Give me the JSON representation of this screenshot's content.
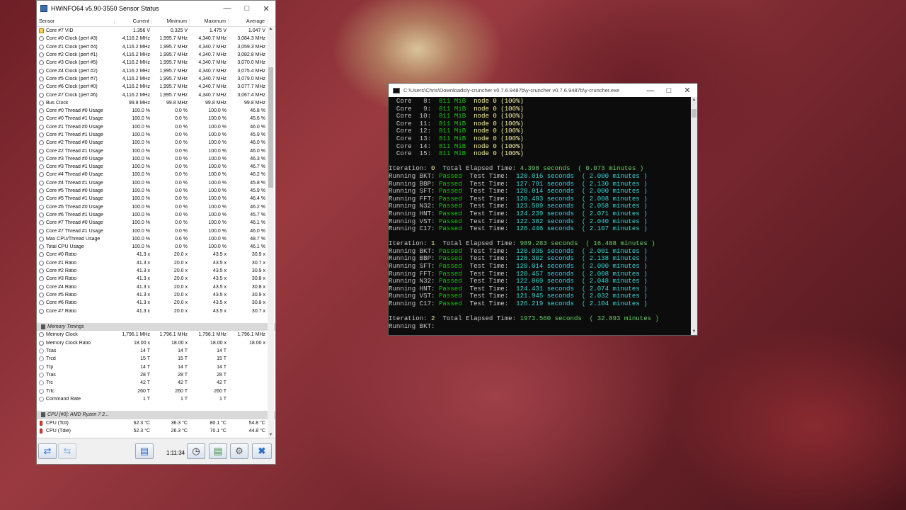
{
  "hwinfo": {
    "title": "HWiNFO64 v5.90-3550 Sensor Status",
    "columns": [
      "Sensor",
      "Current",
      "Minimum",
      "Maximum",
      "Average"
    ],
    "rows": [
      {
        "type": "row",
        "icon": "volt",
        "name": "Core #7 VID",
        "cur": "1.356 V",
        "min": "0.325 V",
        "max": "1.475 V",
        "avg": "1.047 V"
      },
      {
        "type": "row",
        "icon": "clock",
        "name": "Core #0 Clock (perf #3)",
        "cur": "4,116.2 MHz",
        "min": "1,995.7 MHz",
        "max": "4,340.7 MHz",
        "avg": "3,084.3 MHz"
      },
      {
        "type": "row",
        "icon": "clock",
        "name": "Core #1 Clock (perf #4)",
        "cur": "4,116.2 MHz",
        "min": "1,995.7 MHz",
        "max": "4,340.7 MHz",
        "avg": "3,059.3 MHz"
      },
      {
        "type": "row",
        "icon": "clock",
        "name": "Core #2 Clock (perf #1)",
        "cur": "4,116.2 MHz",
        "min": "1,995.7 MHz",
        "max": "4,340.7 MHz",
        "avg": "3,082.8 MHz"
      },
      {
        "type": "row",
        "icon": "clock",
        "name": "Core #3 Clock (perf #5)",
        "cur": "4,116.2 MHz",
        "min": "1,995.7 MHz",
        "max": "4,340.7 MHz",
        "avg": "3,070.0 MHz"
      },
      {
        "type": "row",
        "icon": "clock",
        "name": "Core #4 Clock (perf #2)",
        "cur": "4,116.2 MHz",
        "min": "1,995.7 MHz",
        "max": "4,340.7 MHz",
        "avg": "3,075.4 MHz"
      },
      {
        "type": "row",
        "icon": "clock",
        "name": "Core #5 Clock (perf #7)",
        "cur": "4,116.2 MHz",
        "min": "1,995.7 MHz",
        "max": "4,340.7 MHz",
        "avg": "3,079.0 MHz"
      },
      {
        "type": "row",
        "icon": "clock",
        "name": "Core #6 Clock (perf #0)",
        "cur": "4,116.2 MHz",
        "min": "1,995.7 MHz",
        "max": "4,340.7 MHz",
        "avg": "3,077.7 MHz"
      },
      {
        "type": "row",
        "icon": "clock",
        "name": "Core #7 Clock (perf #6)",
        "cur": "4,116.2 MHz",
        "min": "1,995.7 MHz",
        "max": "4,340.7 MHz",
        "avg": "3,067.4 MHz"
      },
      {
        "type": "row",
        "icon": "clock",
        "name": "Bus Clock",
        "cur": "99.8 MHz",
        "min": "99.8 MHz",
        "max": "99.8 MHz",
        "avg": "99.8 MHz"
      },
      {
        "type": "row",
        "icon": "clock",
        "name": "Core #0 Thread #0 Usage",
        "cur": "100.0 %",
        "min": "0.0 %",
        "max": "100.0 %",
        "avg": "46.8 %"
      },
      {
        "type": "row",
        "icon": "clock",
        "name": "Core #0 Thread #1 Usage",
        "cur": "100.0 %",
        "min": "0.0 %",
        "max": "100.0 %",
        "avg": "45.6 %"
      },
      {
        "type": "row",
        "icon": "clock",
        "name": "Core #1 Thread #0 Usage",
        "cur": "100.0 %",
        "min": "0.0 %",
        "max": "100.0 %",
        "avg": "46.0 %"
      },
      {
        "type": "row",
        "icon": "clock",
        "name": "Core #1 Thread #1 Usage",
        "cur": "100.0 %",
        "min": "0.0 %",
        "max": "100.0 %",
        "avg": "45.9 %"
      },
      {
        "type": "row",
        "icon": "clock",
        "name": "Core #2 Thread #0 Usage",
        "cur": "100.0 %",
        "min": "0.0 %",
        "max": "100.0 %",
        "avg": "46.0 %"
      },
      {
        "type": "row",
        "icon": "clock",
        "name": "Core #2 Thread #1 Usage",
        "cur": "100.0 %",
        "min": "0.0 %",
        "max": "100.0 %",
        "avg": "46.0 %"
      },
      {
        "type": "row",
        "icon": "clock",
        "name": "Core #3 Thread #0 Usage",
        "cur": "100.0 %",
        "min": "0.0 %",
        "max": "100.0 %",
        "avg": "46.3 %"
      },
      {
        "type": "row",
        "icon": "clock",
        "name": "Core #3 Thread #1 Usage",
        "cur": "100.0 %",
        "min": "0.0 %",
        "max": "100.0 %",
        "avg": "46.7 %"
      },
      {
        "type": "row",
        "icon": "clock",
        "name": "Core #4 Thread #0 Usage",
        "cur": "100.0 %",
        "min": "0.0 %",
        "max": "100.0 %",
        "avg": "46.2 %"
      },
      {
        "type": "row",
        "icon": "clock",
        "name": "Core #4 Thread #1 Usage",
        "cur": "100.0 %",
        "min": "0.0 %",
        "max": "100.0 %",
        "avg": "45.8 %"
      },
      {
        "type": "row",
        "icon": "clock",
        "name": "Core #5 Thread #0 Usage",
        "cur": "100.0 %",
        "min": "0.0 %",
        "max": "100.0 %",
        "avg": "45.9 %"
      },
      {
        "type": "row",
        "icon": "clock",
        "name": "Core #5 Thread #1 Usage",
        "cur": "100.0 %",
        "min": "0.0 %",
        "max": "100.0 %",
        "avg": "46.4 %"
      },
      {
        "type": "row",
        "icon": "clock",
        "name": "Core #6 Thread #0 Usage",
        "cur": "100.0 %",
        "min": "0.0 %",
        "max": "100.0 %",
        "avg": "46.2 %"
      },
      {
        "type": "row",
        "icon": "clock",
        "name": "Core #6 Thread #1 Usage",
        "cur": "100.0 %",
        "min": "0.0 %",
        "max": "100.0 %",
        "avg": "45.7 %"
      },
      {
        "type": "row",
        "icon": "clock",
        "name": "Core #7 Thread #0 Usage",
        "cur": "100.0 %",
        "min": "0.0 %",
        "max": "100.0 %",
        "avg": "46.1 %"
      },
      {
        "type": "row",
        "icon": "clock",
        "name": "Core #7 Thread #1 Usage",
        "cur": "100.0 %",
        "min": "0.0 %",
        "max": "100.0 %",
        "avg": "46.0 %"
      },
      {
        "type": "row",
        "icon": "clock",
        "name": "Max CPU/Thread Usage",
        "cur": "100.0 %",
        "min": "0.6 %",
        "max": "100.0 %",
        "avg": "48.7 %"
      },
      {
        "type": "row",
        "icon": "clock",
        "name": "Total CPU Usage",
        "cur": "100.0 %",
        "min": "0.0 %",
        "max": "100.0 %",
        "avg": "46.1 %"
      },
      {
        "type": "row",
        "icon": "clock",
        "name": "Core #0 Ratio",
        "cur": "41.3 x",
        "min": "20.0 x",
        "max": "43.5 x",
        "avg": "30.9 x"
      },
      {
        "type": "row",
        "icon": "clock",
        "name": "Core #1 Ratio",
        "cur": "41.3 x",
        "min": "20.0 x",
        "max": "43.5 x",
        "avg": "30.7 x"
      },
      {
        "type": "row",
        "icon": "clock",
        "name": "Core #2 Ratio",
        "cur": "41.3 x",
        "min": "20.0 x",
        "max": "43.5 x",
        "avg": "30.9 x"
      },
      {
        "type": "row",
        "icon": "clock",
        "name": "Core #3 Ratio",
        "cur": "41.3 x",
        "min": "20.0 x",
        "max": "43.5 x",
        "avg": "30.8 x"
      },
      {
        "type": "row",
        "icon": "clock",
        "name": "Core #4 Ratio",
        "cur": "41.3 x",
        "min": "20.0 x",
        "max": "43.5 x",
        "avg": "30.8 x"
      },
      {
        "type": "row",
        "icon": "clock",
        "name": "Core #5 Ratio",
        "cur": "41.3 x",
        "min": "20.0 x",
        "max": "43.5 x",
        "avg": "30.9 x"
      },
      {
        "type": "row",
        "icon": "clock",
        "name": "Core #6 Ratio",
        "cur": "41.3 x",
        "min": "20.0 x",
        "max": "43.5 x",
        "avg": "30.8 x"
      },
      {
        "type": "row",
        "icon": "clock",
        "name": "Core #7 Ratio",
        "cur": "41.3 x",
        "min": "20.0 x",
        "max": "43.5 x",
        "avg": "30.7 x"
      },
      {
        "type": "spacer"
      },
      {
        "type": "group",
        "name": "Memory Timings"
      },
      {
        "type": "row",
        "icon": "clock",
        "name": "Memory Clock",
        "cur": "1,796.1 MHz",
        "min": "1,796.1 MHz",
        "max": "1,796.1 MHz",
        "avg": "1,796.1 MHz"
      },
      {
        "type": "row",
        "icon": "clock",
        "name": "Memory Clock Ratio",
        "cur": "18.00 x",
        "min": "18.00 x",
        "max": "18.00 x",
        "avg": "18.00 x"
      },
      {
        "type": "row",
        "icon": "plain",
        "name": "Tcas",
        "cur": "14 T",
        "min": "14 T",
        "max": "14 T",
        "avg": ""
      },
      {
        "type": "row",
        "icon": "plain",
        "name": "Trcd",
        "cur": "15 T",
        "min": "15 T",
        "max": "15 T",
        "avg": ""
      },
      {
        "type": "row",
        "icon": "plain",
        "name": "Trp",
        "cur": "14 T",
        "min": "14 T",
        "max": "14 T",
        "avg": ""
      },
      {
        "type": "row",
        "icon": "plain",
        "name": "Tras",
        "cur": "28 T",
        "min": "28 T",
        "max": "28 T",
        "avg": ""
      },
      {
        "type": "row",
        "icon": "plain",
        "name": "Trc",
        "cur": "42 T",
        "min": "42 T",
        "max": "42 T",
        "avg": ""
      },
      {
        "type": "row",
        "icon": "plain",
        "name": "Trfc",
        "cur": "260 T",
        "min": "260 T",
        "max": "260 T",
        "avg": ""
      },
      {
        "type": "row",
        "icon": "plain",
        "name": "Command Rate",
        "cur": "1 T",
        "min": "1 T",
        "max": "1 T",
        "avg": ""
      },
      {
        "type": "spacer"
      },
      {
        "type": "group",
        "name": "CPU [#0]: AMD Ryzen 7 2..."
      },
      {
        "type": "row",
        "icon": "therm",
        "name": "CPU (Tctl)",
        "cur": "62.3 °C",
        "min": "36.3 °C",
        "max": "80.1 °C",
        "avg": "54.8 °C"
      },
      {
        "type": "row",
        "icon": "therm",
        "name": "CPU (Tdie)",
        "cur": "52.3 °C",
        "min": "26.3 °C",
        "max": "70.1 °C",
        "avg": "44.8 °C"
      }
    ],
    "footer": {
      "timer": "1:11:34"
    }
  },
  "console": {
    "title": "C:\\Users\\Chris\\Downloads\\y-cruncher v0.7.6.9487b\\y-cruncher v0.7.6.9487b\\y-cruncher.exe",
    "lines": [
      [
        {
          "t": "  Core   8:  ",
          "c": "w"
        },
        {
          "t": "811 MiB",
          "c": "g"
        },
        {
          "t": "  node 0 (100%)",
          "c": "y"
        }
      ],
      [
        {
          "t": "  Core   9:  ",
          "c": "w"
        },
        {
          "t": "811 MiB",
          "c": "g"
        },
        {
          "t": "  node 0 (100%)",
          "c": "y"
        }
      ],
      [
        {
          "t": "  Core  10:  ",
          "c": "w"
        },
        {
          "t": "811 MiB",
          "c": "g"
        },
        {
          "t": "  node 0 (100%)",
          "c": "y"
        }
      ],
      [
        {
          "t": "  Core  11:  ",
          "c": "w"
        },
        {
          "t": "811 MiB",
          "c": "g"
        },
        {
          "t": "  node 0 (100%)",
          "c": "y"
        }
      ],
      [
        {
          "t": "  Core  12:  ",
          "c": "w"
        },
        {
          "t": "811 MiB",
          "c": "g"
        },
        {
          "t": "  node 0 (100%)",
          "c": "y"
        }
      ],
      [
        {
          "t": "  Core  13:  ",
          "c": "w"
        },
        {
          "t": "811 MiB",
          "c": "g"
        },
        {
          "t": "  node 0 (100%)",
          "c": "y"
        }
      ],
      [
        {
          "t": "  Core  14:  ",
          "c": "w"
        },
        {
          "t": "811 MiB",
          "c": "g"
        },
        {
          "t": "  node 0 (100%)",
          "c": "y"
        }
      ],
      [
        {
          "t": "  Core  15:  ",
          "c": "w"
        },
        {
          "t": "811 MiB",
          "c": "g"
        },
        {
          "t": "  node 0 (100%)",
          "c": "y"
        }
      ],
      [
        {
          "t": "",
          "c": "w"
        }
      ],
      [
        {
          "t": "Iteration: ",
          "c": "w"
        },
        {
          "t": "0",
          "c": "y"
        },
        {
          "t": "  Total Elapsed Time: ",
          "c": "w"
        },
        {
          "t": "4.398 seconds  ( 0.073 minutes )",
          "c": "lg"
        }
      ],
      [
        {
          "t": "Running BKT: ",
          "c": "w"
        },
        {
          "t": "Passed",
          "c": "g"
        },
        {
          "t": "  Test Time:  ",
          "c": "w"
        },
        {
          "t": "120.016 seconds  ( 2.000 minutes )",
          "c": "c"
        }
      ],
      [
        {
          "t": "Running BBP: ",
          "c": "w"
        },
        {
          "t": "Passed",
          "c": "g"
        },
        {
          "t": "  Test Time:  ",
          "c": "w"
        },
        {
          "t": "127.791 seconds  ( 2.130 minutes )",
          "c": "c"
        }
      ],
      [
        {
          "t": "Running SFT: ",
          "c": "w"
        },
        {
          "t": "Passed",
          "c": "g"
        },
        {
          "t": "  Test Time:  ",
          "c": "w"
        },
        {
          "t": "120.014 seconds  ( 2.000 minutes )",
          "c": "c"
        }
      ],
      [
        {
          "t": "Running FFT: ",
          "c": "w"
        },
        {
          "t": "Passed",
          "c": "g"
        },
        {
          "t": "  Test Time:  ",
          "c": "w"
        },
        {
          "t": "120.483 seconds  ( 2.008 minutes )",
          "c": "c"
        }
      ],
      [
        {
          "t": "Running N32: ",
          "c": "w"
        },
        {
          "t": "Passed",
          "c": "g"
        },
        {
          "t": "  Test Time:  ",
          "c": "w"
        },
        {
          "t": "123.509 seconds  ( 2.058 minutes )",
          "c": "c"
        }
      ],
      [
        {
          "t": "Running HNT: ",
          "c": "w"
        },
        {
          "t": "Passed",
          "c": "g"
        },
        {
          "t": "  Test Time:  ",
          "c": "w"
        },
        {
          "t": "124.239 seconds  ( 2.071 minutes )",
          "c": "c"
        }
      ],
      [
        {
          "t": "Running VST: ",
          "c": "w"
        },
        {
          "t": "Passed",
          "c": "g"
        },
        {
          "t": "  Test Time:  ",
          "c": "w"
        },
        {
          "t": "122.382 seconds  ( 2.040 minutes )",
          "c": "c"
        }
      ],
      [
        {
          "t": "Running C17: ",
          "c": "w"
        },
        {
          "t": "Passed",
          "c": "g"
        },
        {
          "t": "  Test Time:  ",
          "c": "w"
        },
        {
          "t": "126.446 seconds  ( 2.107 minutes )",
          "c": "c"
        }
      ],
      [
        {
          "t": "",
          "c": "w"
        }
      ],
      [
        {
          "t": "Iteration: ",
          "c": "w"
        },
        {
          "t": "1",
          "c": "y"
        },
        {
          "t": "  Total Elapsed Time: ",
          "c": "w"
        },
        {
          "t": "989.283 seconds  ( 16.488 minutes )",
          "c": "lg"
        }
      ],
      [
        {
          "t": "Running BKT: ",
          "c": "w"
        },
        {
          "t": "Passed",
          "c": "g"
        },
        {
          "t": "  Test Time:  ",
          "c": "w"
        },
        {
          "t": "120.035 seconds  ( 2.001 minutes )",
          "c": "c"
        }
      ],
      [
        {
          "t": "Running BBP: ",
          "c": "w"
        },
        {
          "t": "Passed",
          "c": "g"
        },
        {
          "t": "  Test Time:  ",
          "c": "w"
        },
        {
          "t": "128.302 seconds  ( 2.138 minutes )",
          "c": "c"
        }
      ],
      [
        {
          "t": "Running SFT: ",
          "c": "w"
        },
        {
          "t": "Passed",
          "c": "g"
        },
        {
          "t": "  Test Time:  ",
          "c": "w"
        },
        {
          "t": "120.014 seconds  ( 2.000 minutes )",
          "c": "c"
        }
      ],
      [
        {
          "t": "Running FFT: ",
          "c": "w"
        },
        {
          "t": "Passed",
          "c": "g"
        },
        {
          "t": "  Test Time:  ",
          "c": "w"
        },
        {
          "t": "120.457 seconds  ( 2.008 minutes )",
          "c": "c"
        }
      ],
      [
        {
          "t": "Running N32: ",
          "c": "w"
        },
        {
          "t": "Passed",
          "c": "g"
        },
        {
          "t": "  Test Time:  ",
          "c": "w"
        },
        {
          "t": "122.869 seconds  ( 2.048 minutes )",
          "c": "c"
        }
      ],
      [
        {
          "t": "Running HNT: ",
          "c": "w"
        },
        {
          "t": "Passed",
          "c": "g"
        },
        {
          "t": "  Test Time:  ",
          "c": "w"
        },
        {
          "t": "124.431 seconds  ( 2.074 minutes )",
          "c": "c"
        }
      ],
      [
        {
          "t": "Running VST: ",
          "c": "w"
        },
        {
          "t": "Passed",
          "c": "g"
        },
        {
          "t": "  Test Time:  ",
          "c": "w"
        },
        {
          "t": "121.945 seconds  ( 2.032 minutes )",
          "c": "c"
        }
      ],
      [
        {
          "t": "Running C17: ",
          "c": "w"
        },
        {
          "t": "Passed",
          "c": "g"
        },
        {
          "t": "  Test Time:  ",
          "c": "w"
        },
        {
          "t": "126.219 seconds  ( 2.104 minutes )",
          "c": "c"
        }
      ],
      [
        {
          "t": "",
          "c": "w"
        }
      ],
      [
        {
          "t": "Iteration: ",
          "c": "w"
        },
        {
          "t": "2",
          "c": "y"
        },
        {
          "t": "  Total Elapsed Time: ",
          "c": "w"
        },
        {
          "t": "1973.560 seconds  ( 32.893 minutes )",
          "c": "lg"
        }
      ],
      [
        {
          "t": "Running BKT:",
          "c": "w"
        }
      ]
    ]
  },
  "colors": {
    "console_bg": "#0c0c0c",
    "console_green": "#16c60c",
    "console_yellow": "#f9f1a5",
    "console_cyan": "#3ad6d6",
    "close_accent": "#2b6fcf"
  }
}
